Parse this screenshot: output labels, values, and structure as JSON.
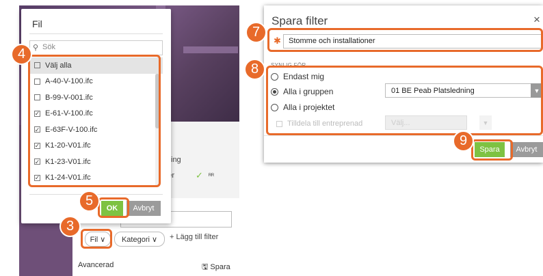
{
  "fil_dropdown": {
    "title": "Fil",
    "search_placeholder": "Sök",
    "items": [
      {
        "label": "Välj alla",
        "checked": false
      },
      {
        "label": "A-40-V-100.ifc",
        "checked": false
      },
      {
        "label": "B-99-V-001.ifc",
        "checked": false
      },
      {
        "label": "E-61-V-100.ifc",
        "checked": true
      },
      {
        "label": "E-63F-V-100.ifc",
        "checked": true
      },
      {
        "label": "K1-20-V01.ifc",
        "checked": true
      },
      {
        "label": "K1-23-V01.ifc",
        "checked": true
      },
      {
        "label": "K1-24-V01.ifc",
        "checked": true
      }
    ],
    "ok_label": "OK",
    "cancel_label": "Avbryt"
  },
  "filter_bar": {
    "fil_chip": "Fil ∨",
    "kategori_chip": "Kategori ∨",
    "add_filter": "+ Lägg till filter",
    "avancerad": "Avancerad",
    "spara": "🖫 Spara",
    "hint_ing": "ing",
    "hint_oner": "oner"
  },
  "save_dialog": {
    "title": "Spara filter",
    "close": "×",
    "name_value": "Stomme och installationer",
    "visible_for_label": "SYNLIG FÖR",
    "options": [
      {
        "label": "Endast mig",
        "selected": false
      },
      {
        "label": "Alla i gruppen",
        "selected": true
      },
      {
        "label": "Alla i projektet",
        "selected": false
      }
    ],
    "group_value": "01 BE Peab Platsledning",
    "assign_label": "Tilldela till entreprenad",
    "assign_placeholder": "Välj...",
    "save_label": "Spara",
    "cancel_label": "Avbryt"
  },
  "callouts": [
    "3",
    "4",
    "5",
    "7",
    "8",
    "9"
  ],
  "colors": {
    "accent_orange": "#e86a2a",
    "ok_green": "#7ec242",
    "cancel_gray": "#9b9b9b"
  }
}
